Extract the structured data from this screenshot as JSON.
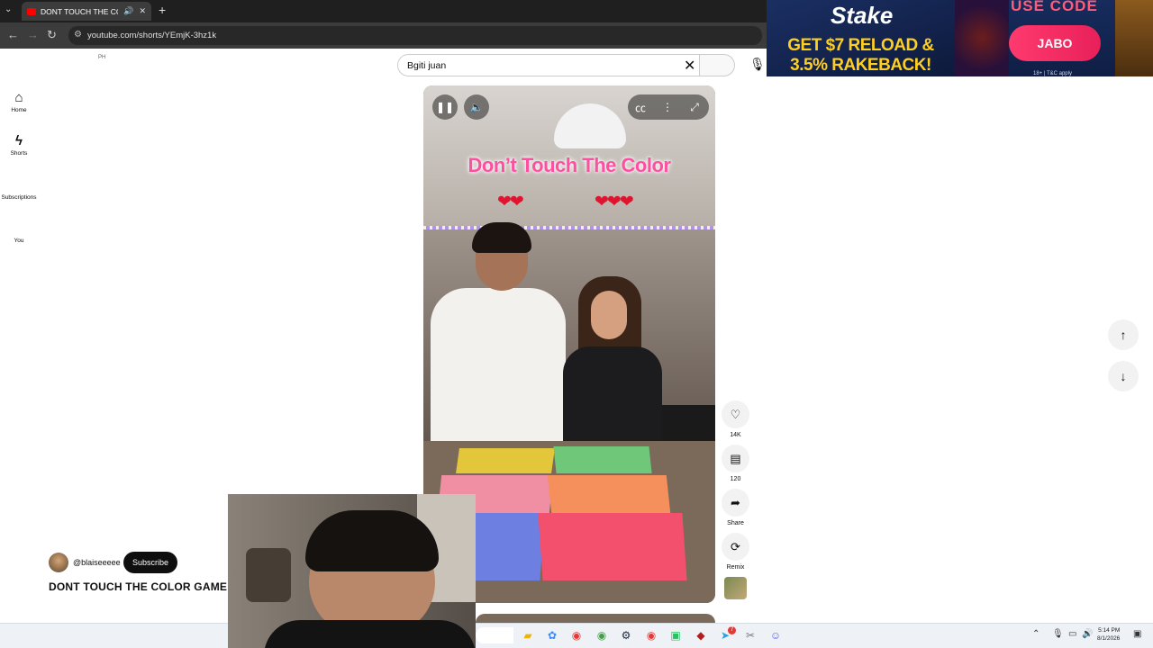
{
  "browser": {
    "tab_title": "DONT TOUCH THE COLOR GAME",
    "url": "youtube.com/shorts/YEmjK-3hz1k",
    "new_tab": "+",
    "close_tab": "✕"
  },
  "ad": {
    "brand": "Stake",
    "headline": "GET $7 RELOAD & 3.5% RAKEBACK!",
    "use_code": "USE CODE",
    "code": "JABO",
    "fine_print": "18+ | T&C apply"
  },
  "youtube": {
    "country_code": "PH",
    "sidebar": [
      {
        "label": "Home",
        "icon": "home-icon",
        "glyph": "⌂"
      },
      {
        "label": "Shorts",
        "icon": "shorts-icon",
        "glyph": "ϟ"
      },
      {
        "label": "Subscriptions",
        "icon": "subscriptions-icon",
        "glyph": ""
      },
      {
        "label": "You",
        "icon": "you-icon",
        "glyph": ""
      }
    ],
    "search": {
      "value": "Bgiti juan"
    },
    "video": {
      "overlay_title": "Don’t Touch The Color",
      "hearts_left": "❤❤",
      "hearts_right": "❤❤❤"
    },
    "actions": [
      {
        "name": "like",
        "icon": "like-icon",
        "glyph": "♡",
        "label": "14K"
      },
      {
        "name": "comments",
        "icon": "comment-icon",
        "glyph": "▤",
        "label": "120"
      },
      {
        "name": "share",
        "icon": "share-icon",
        "glyph": "➦",
        "label": "Share"
      },
      {
        "name": "remix",
        "icon": "remix-icon",
        "glyph": "⟳",
        "label": "Remix"
      }
    ],
    "channel": {
      "handle": "@blaiseeeee",
      "subscribe_label": "Subscribe"
    },
    "video_title": "DONT TOUCH THE COLOR GAME",
    "mats": [
      {
        "color": "#e3c63a"
      },
      {
        "color": "#6fc77a"
      },
      {
        "color": "#f08fa3"
      },
      {
        "color": "#f58f5c"
      },
      {
        "color": "#6d7fe0"
      },
      {
        "color": "#f2506d"
      }
    ]
  },
  "taskbar": {
    "time": "5:14 PM",
    "date": "8/1/2026",
    "badge_count": "7"
  }
}
